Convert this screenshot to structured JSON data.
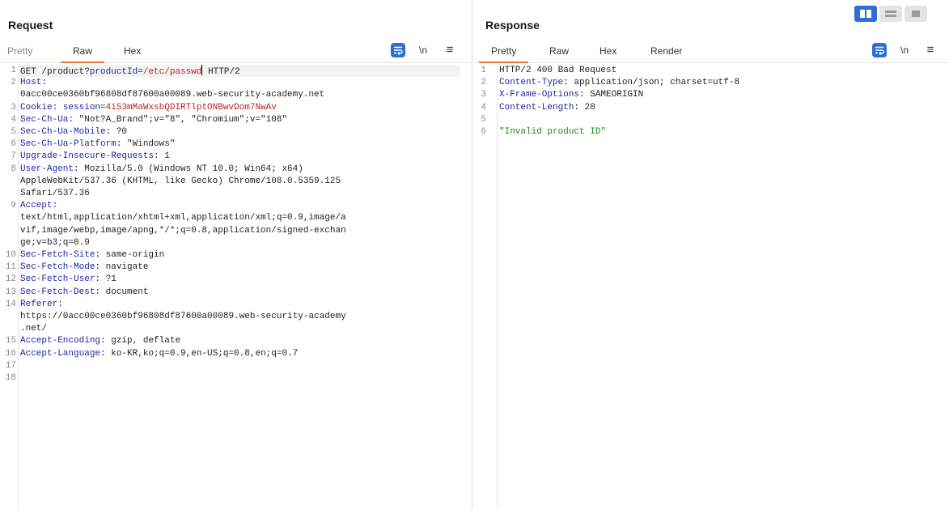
{
  "request": {
    "title": "Request",
    "tabs": [
      "Pretty",
      "Raw",
      "Hex"
    ],
    "active_tab": "Raw",
    "tools": {
      "newline": "\\n"
    },
    "lines": [
      {
        "num": "1",
        "parts": [
          [
            "",
            "GET /product?"
          ],
          [
            "param",
            "productId"
          ],
          [
            "",
            "="
          ],
          [
            "val",
            "/etc/passwd"
          ],
          [
            "cursor",
            ""
          ],
          [
            "",
            " HTTP/2"
          ]
        ]
      },
      {
        "num": "2",
        "parts": [
          [
            "hdr",
            "Host"
          ],
          [
            "",
            ":"
          ]
        ]
      },
      {
        "num": "",
        "parts": [
          [
            "",
            "0acc00ce0360bf96808df87600a00089.web-security-academy.net"
          ]
        ]
      },
      {
        "num": "3",
        "parts": [
          [
            "hdr",
            "Cookie"
          ],
          [
            "",
            ": "
          ],
          [
            "hdr",
            "session"
          ],
          [
            "",
            "="
          ],
          [
            "val",
            "4iS3mMaWxsbQDIRTlptONBwvDom7NwAv"
          ]
        ]
      },
      {
        "num": "4",
        "parts": [
          [
            "hdr",
            "Sec-Ch-Ua"
          ],
          [
            "",
            ": \"Not?A_Brand\";v=\"8\", \"Chromium\";v=\"108\""
          ]
        ]
      },
      {
        "num": "5",
        "parts": [
          [
            "hdr",
            "Sec-Ch-Ua-Mobile"
          ],
          [
            "",
            ": ?0"
          ]
        ]
      },
      {
        "num": "6",
        "parts": [
          [
            "hdr",
            "Sec-Ch-Ua-Platform"
          ],
          [
            "",
            ": \"Windows\""
          ]
        ]
      },
      {
        "num": "7",
        "parts": [
          [
            "hdr",
            "Upgrade-Insecure-Requests"
          ],
          [
            "",
            ": 1"
          ]
        ]
      },
      {
        "num": "8",
        "parts": [
          [
            "hdr",
            "User-Agent"
          ],
          [
            "",
            ": Mozilla/5.0 (Windows NT 10.0; Win64; x64)"
          ]
        ]
      },
      {
        "num": "",
        "parts": [
          [
            "",
            "AppleWebKit/537.36 (KHTML, like Gecko) Chrome/108.0.5359.125"
          ]
        ]
      },
      {
        "num": "",
        "parts": [
          [
            "",
            "Safari/537.36"
          ]
        ]
      },
      {
        "num": "9",
        "parts": [
          [
            "hdr",
            "Accept"
          ],
          [
            "",
            ":"
          ]
        ]
      },
      {
        "num": "",
        "parts": [
          [
            "",
            "text/html,application/xhtml+xml,application/xml;q=0.9,image/a"
          ]
        ]
      },
      {
        "num": "",
        "parts": [
          [
            "",
            "vif,image/webp,image/apng,*/*;q=0.8,application/signed-exchan"
          ]
        ]
      },
      {
        "num": "",
        "parts": [
          [
            "",
            "ge;v=b3;q=0.9"
          ]
        ]
      },
      {
        "num": "10",
        "parts": [
          [
            "hdr",
            "Sec-Fetch-Site"
          ],
          [
            "",
            ": same-origin"
          ]
        ]
      },
      {
        "num": "11",
        "parts": [
          [
            "hdr",
            "Sec-Fetch-Mode"
          ],
          [
            "",
            ": navigate"
          ]
        ]
      },
      {
        "num": "12",
        "parts": [
          [
            "hdr",
            "Sec-Fetch-User"
          ],
          [
            "",
            ": ?1"
          ]
        ]
      },
      {
        "num": "13",
        "parts": [
          [
            "hdr",
            "Sec-Fetch-Dest"
          ],
          [
            "",
            ": document"
          ]
        ]
      },
      {
        "num": "14",
        "parts": [
          [
            "hdr",
            "Referer"
          ],
          [
            "",
            ":"
          ]
        ]
      },
      {
        "num": "",
        "parts": [
          [
            "",
            "https://0acc00ce0360bf96808df87600a00089.web-security-academy"
          ]
        ]
      },
      {
        "num": "",
        "parts": [
          [
            "",
            ".net/"
          ]
        ]
      },
      {
        "num": "15",
        "parts": [
          [
            "hdr",
            "Accept-Encoding"
          ],
          [
            "",
            ": gzip, deflate"
          ]
        ]
      },
      {
        "num": "16",
        "parts": [
          [
            "hdr",
            "Accept-Language"
          ],
          [
            "",
            ": ko-KR,ko;q=0.9,en-US;q=0.8,en;q=0.7"
          ]
        ]
      },
      {
        "num": "17",
        "parts": []
      },
      {
        "num": "18",
        "parts": []
      }
    ]
  },
  "response": {
    "title": "Response",
    "tabs": [
      "Pretty",
      "Raw",
      "Hex",
      "Render"
    ],
    "active_tab": "Pretty",
    "tools": {
      "newline": "\\n"
    },
    "lines": [
      {
        "num": "1",
        "parts": [
          [
            "",
            "HTTP/2 400 Bad Request"
          ]
        ]
      },
      {
        "num": "2",
        "parts": [
          [
            "hdr",
            "Content-Type"
          ],
          [
            "",
            ": application/json; charset=utf-8"
          ]
        ]
      },
      {
        "num": "3",
        "parts": [
          [
            "hdr",
            "X-Frame-Options"
          ],
          [
            "",
            ": SAMEORIGIN"
          ]
        ]
      },
      {
        "num": "4",
        "parts": [
          [
            "hdr",
            "Content-Length"
          ],
          [
            "",
            ": 20"
          ]
        ]
      },
      {
        "num": "5",
        "parts": []
      },
      {
        "num": "6",
        "parts": [
          [
            "str",
            "\"Invalid product ID\""
          ]
        ]
      }
    ]
  },
  "colors": {
    "accent": "#e8733d",
    "button_blue": "#2f6fd1",
    "header_name": "#1a28a6",
    "value_red": "#c0221a",
    "string_green": "#1e8a1e"
  }
}
